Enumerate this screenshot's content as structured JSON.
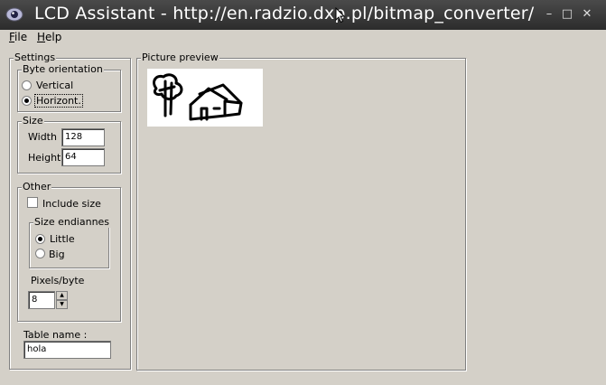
{
  "window": {
    "title": "LCD Assistant -  http://en.radzio.dxp.pl/bitmap_converter/",
    "minimize_glyph": "–",
    "maximize_glyph": "□",
    "close_glyph": "✕"
  },
  "menu": {
    "file": {
      "accel": "F",
      "rest": "ile"
    },
    "help": {
      "accel": "H",
      "rest": "elp"
    }
  },
  "settings": {
    "title": "Settings",
    "byte_orientation": {
      "title": "Byte orientation",
      "options": [
        "Vertical",
        "Horizont."
      ],
      "selected": "Horizont."
    },
    "size": {
      "title": "Size",
      "width_label": "Width",
      "width_value": "128",
      "height_label": "Height",
      "height_value": "64"
    },
    "other": {
      "title": "Other",
      "include_size_label": "Include size",
      "include_size_checked": false,
      "endianness": {
        "title": "Size endiannes",
        "options": [
          "Little",
          "Big"
        ],
        "selected": "Little"
      },
      "pixels_per_byte_label": "Pixels/byte",
      "pixels_per_byte_value": "8"
    },
    "table_name_label": "Table name :",
    "table_name_value": "hola"
  },
  "preview": {
    "title": "Picture preview"
  },
  "colors": {
    "titlebar": "#2c2c2c",
    "window_bg": "#d4d0c8"
  }
}
